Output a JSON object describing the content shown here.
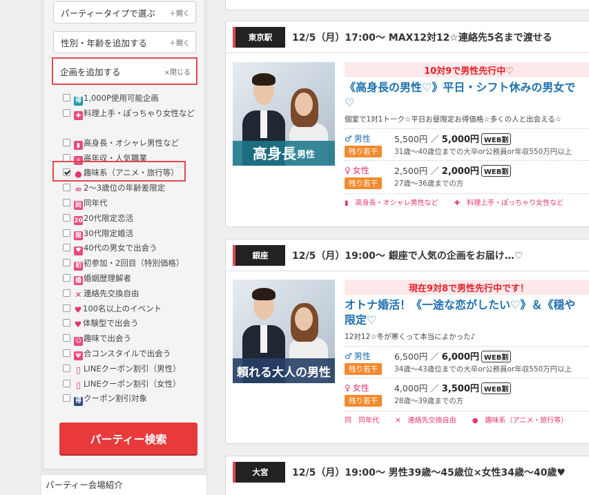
{
  "sidebar": {
    "party_type": {
      "label": "パーティータイプで選ぶ",
      "toggle": "＋開く"
    },
    "gender_age": {
      "label": "性別・年齢を追加する",
      "toggle": "＋開く"
    },
    "plans": {
      "label": "企画を追加する",
      "toggle": "×閉じる"
    },
    "options": [
      {
        "icon": "得",
        "label": "1,000P使用可能企画",
        "checked": false
      },
      {
        "icon": "✚",
        "label": "料理上手・ぽっちゃり女性など",
        "checked": false
      },
      {
        "icon": "▮",
        "label": "高身長・オシャレ男性など",
        "checked": false
      },
      {
        "icon": "♕",
        "label": "高年収・人気職業",
        "checked": false
      },
      {
        "icon": "●",
        "label": "趣味系（アニメ・旅行等）",
        "checked": true
      },
      {
        "icon": "∞",
        "label": "2～3歳位の年齢差限定",
        "checked": false
      },
      {
        "icon": "同",
        "label": "同年代",
        "checked": false
      },
      {
        "icon": "20",
        "label": "20代限定恋活",
        "checked": false
      },
      {
        "icon": "限",
        "label": "30代限定婚活",
        "checked": false
      },
      {
        "icon": "♥",
        "label": "40代の男女で出会う",
        "checked": false
      },
      {
        "icon": "初",
        "label": "初参加・2回目（特別価格）",
        "checked": false
      },
      {
        "icon": "婚",
        "label": "婚姻歴理解者",
        "checked": false
      },
      {
        "icon": "✕",
        "label": "連絡先交換自由",
        "checked": false
      },
      {
        "icon": "♥",
        "label": "100名以上のイベント",
        "checked": false
      },
      {
        "icon": "♥",
        "label": "体験型で出会う",
        "checked": false
      },
      {
        "icon": "☺",
        "label": "趣味で出会う",
        "checked": false
      },
      {
        "icon": "Ψ",
        "label": "合コンスタイルで出会う",
        "checked": false
      },
      {
        "icon": "▯",
        "label": "LINEクーポン割引（男性）",
        "checked": false
      },
      {
        "icon": "▯",
        "label": "LINEクーポン割引（女性）",
        "checked": false
      },
      {
        "icon": "得",
        "label": "クーポン割引対象",
        "checked": false
      }
    ],
    "search_button": "パーティー検索",
    "venue_title": "パーティー会場紹介"
  },
  "events": [
    {
      "location": "東京駅",
      "title": "12/5（月）17:00～ MAX12対12☆連絡先5名まで渡せる",
      "banner_big": "高身長",
      "banner_small": "男性",
      "priority": "10対9で男性先行中♡",
      "event_title_1": "《高身長の男性♡》平日・シフト休みの男女で",
      "event_title_2": "♡",
      "description": "個室で1対1トーク☆平日お昼限定お得価格☆多くの人と出会える☆",
      "male": {
        "label": "男性",
        "tag": "残り若干",
        "regular": "5,500円",
        "sep": "／",
        "web_price": "5,000円",
        "web": "WEB割",
        "condition": "31歳～40歳位までの大卒or公務員or年収550万円以上"
      },
      "female": {
        "label": "女性",
        "tag": "残り若干",
        "regular": "2,500円",
        "sep": "／",
        "web_price": "2,000円",
        "web": "WEB割",
        "condition": "27歳～36歳までの方"
      },
      "tags": [
        "高身長・オシャレ男性など",
        "料理上手・ぽっちゃり女性など"
      ]
    },
    {
      "location": "銀座",
      "title": "12/5（月）19:00～ 銀座で人気の企画をお届け…♡",
      "banner_big": "頼れる大人の男性",
      "banner_small": "",
      "priority": "現在9対8で男性先行中です！",
      "event_title_1": "オトナ婚活！《一途な恋がしたい♡》＆《穏や",
      "event_title_2": "限定♡",
      "description": "12対12☆冬が寒くって本当によかった♪",
      "male": {
        "label": "男性",
        "tag": "残り若干",
        "regular": "6,500円",
        "sep": "／",
        "web_price": "6,000円",
        "web": "WEB割",
        "condition": "34歳～43歳位までの大卒or公務員or年収550万円以上"
      },
      "female": {
        "label": "女性",
        "tag": "残り若干",
        "regular": "4,000円",
        "sep": "／",
        "web_price": "3,500円",
        "web": "WEB割",
        "condition": "28歳～39歳までの方"
      },
      "tags": [
        "同年代",
        "連絡先交換自由",
        "趣味系（アニメ・旅行等）"
      ]
    },
    {
      "location": "大宮",
      "title": "12/5（月）19:00～ 男性39歳～45歳位×女性34歳～40歳♥"
    }
  ],
  "colors": {
    "accent": "#e2474e",
    "link": "#1d6fae",
    "pink": "#e4356d",
    "orange": "#f28a2e",
    "search": "#e83a3a"
  }
}
